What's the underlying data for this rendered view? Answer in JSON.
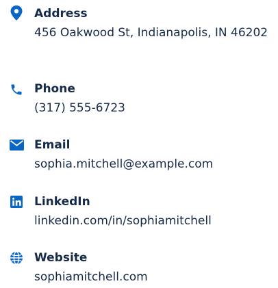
{
  "contact": {
    "accent_color": "#0a66c2",
    "items": [
      {
        "icon": "location-pin-icon",
        "label": "Address",
        "value": "456 Oakwood St, Indianapolis, IN 46202"
      },
      {
        "icon": "phone-icon",
        "label": "Phone",
        "value": "(317) 555-6723"
      },
      {
        "icon": "email-icon",
        "label": "Email",
        "value": "sophia.mitchell@example.com"
      },
      {
        "icon": "linkedin-icon",
        "label": "LinkedIn",
        "value": "linkedin.com/in/sophiamitchell"
      },
      {
        "icon": "globe-icon",
        "label": "Website",
        "value": "sophiamitchell.com"
      }
    ]
  }
}
